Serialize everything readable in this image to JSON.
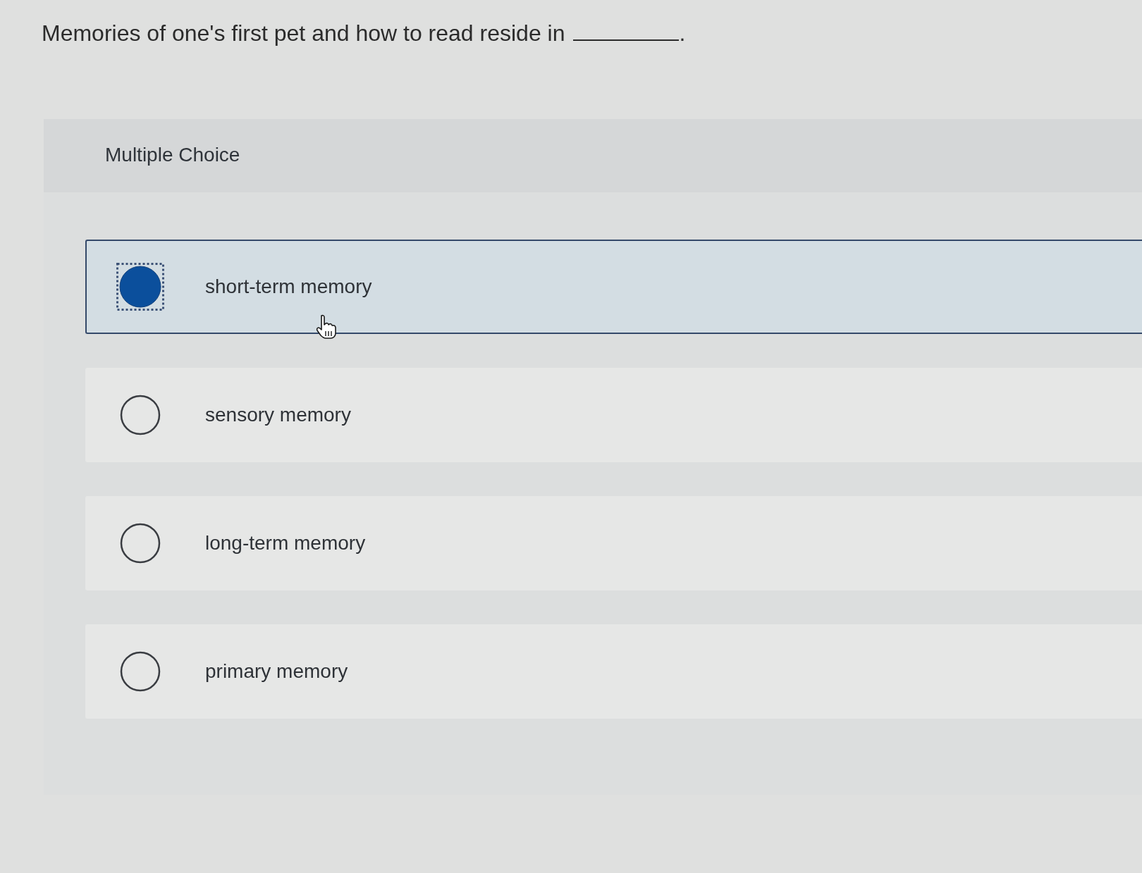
{
  "question": [
    {
      "kind": "text",
      "text": "Memories of one's first pet and how to read reside in"
    },
    {
      "kind": "blank"
    },
    {
      "kind": "text",
      "text": "."
    }
  ],
  "panel": {
    "title": "Multiple Choice"
  },
  "options": [
    {
      "label": "short-term memory",
      "selected": true,
      "focused": true
    },
    {
      "label": "sensory memory",
      "selected": false,
      "focused": false
    },
    {
      "label": "long-term memory",
      "selected": false,
      "focused": false
    },
    {
      "label": "primary memory",
      "selected": false,
      "focused": false
    }
  ]
}
